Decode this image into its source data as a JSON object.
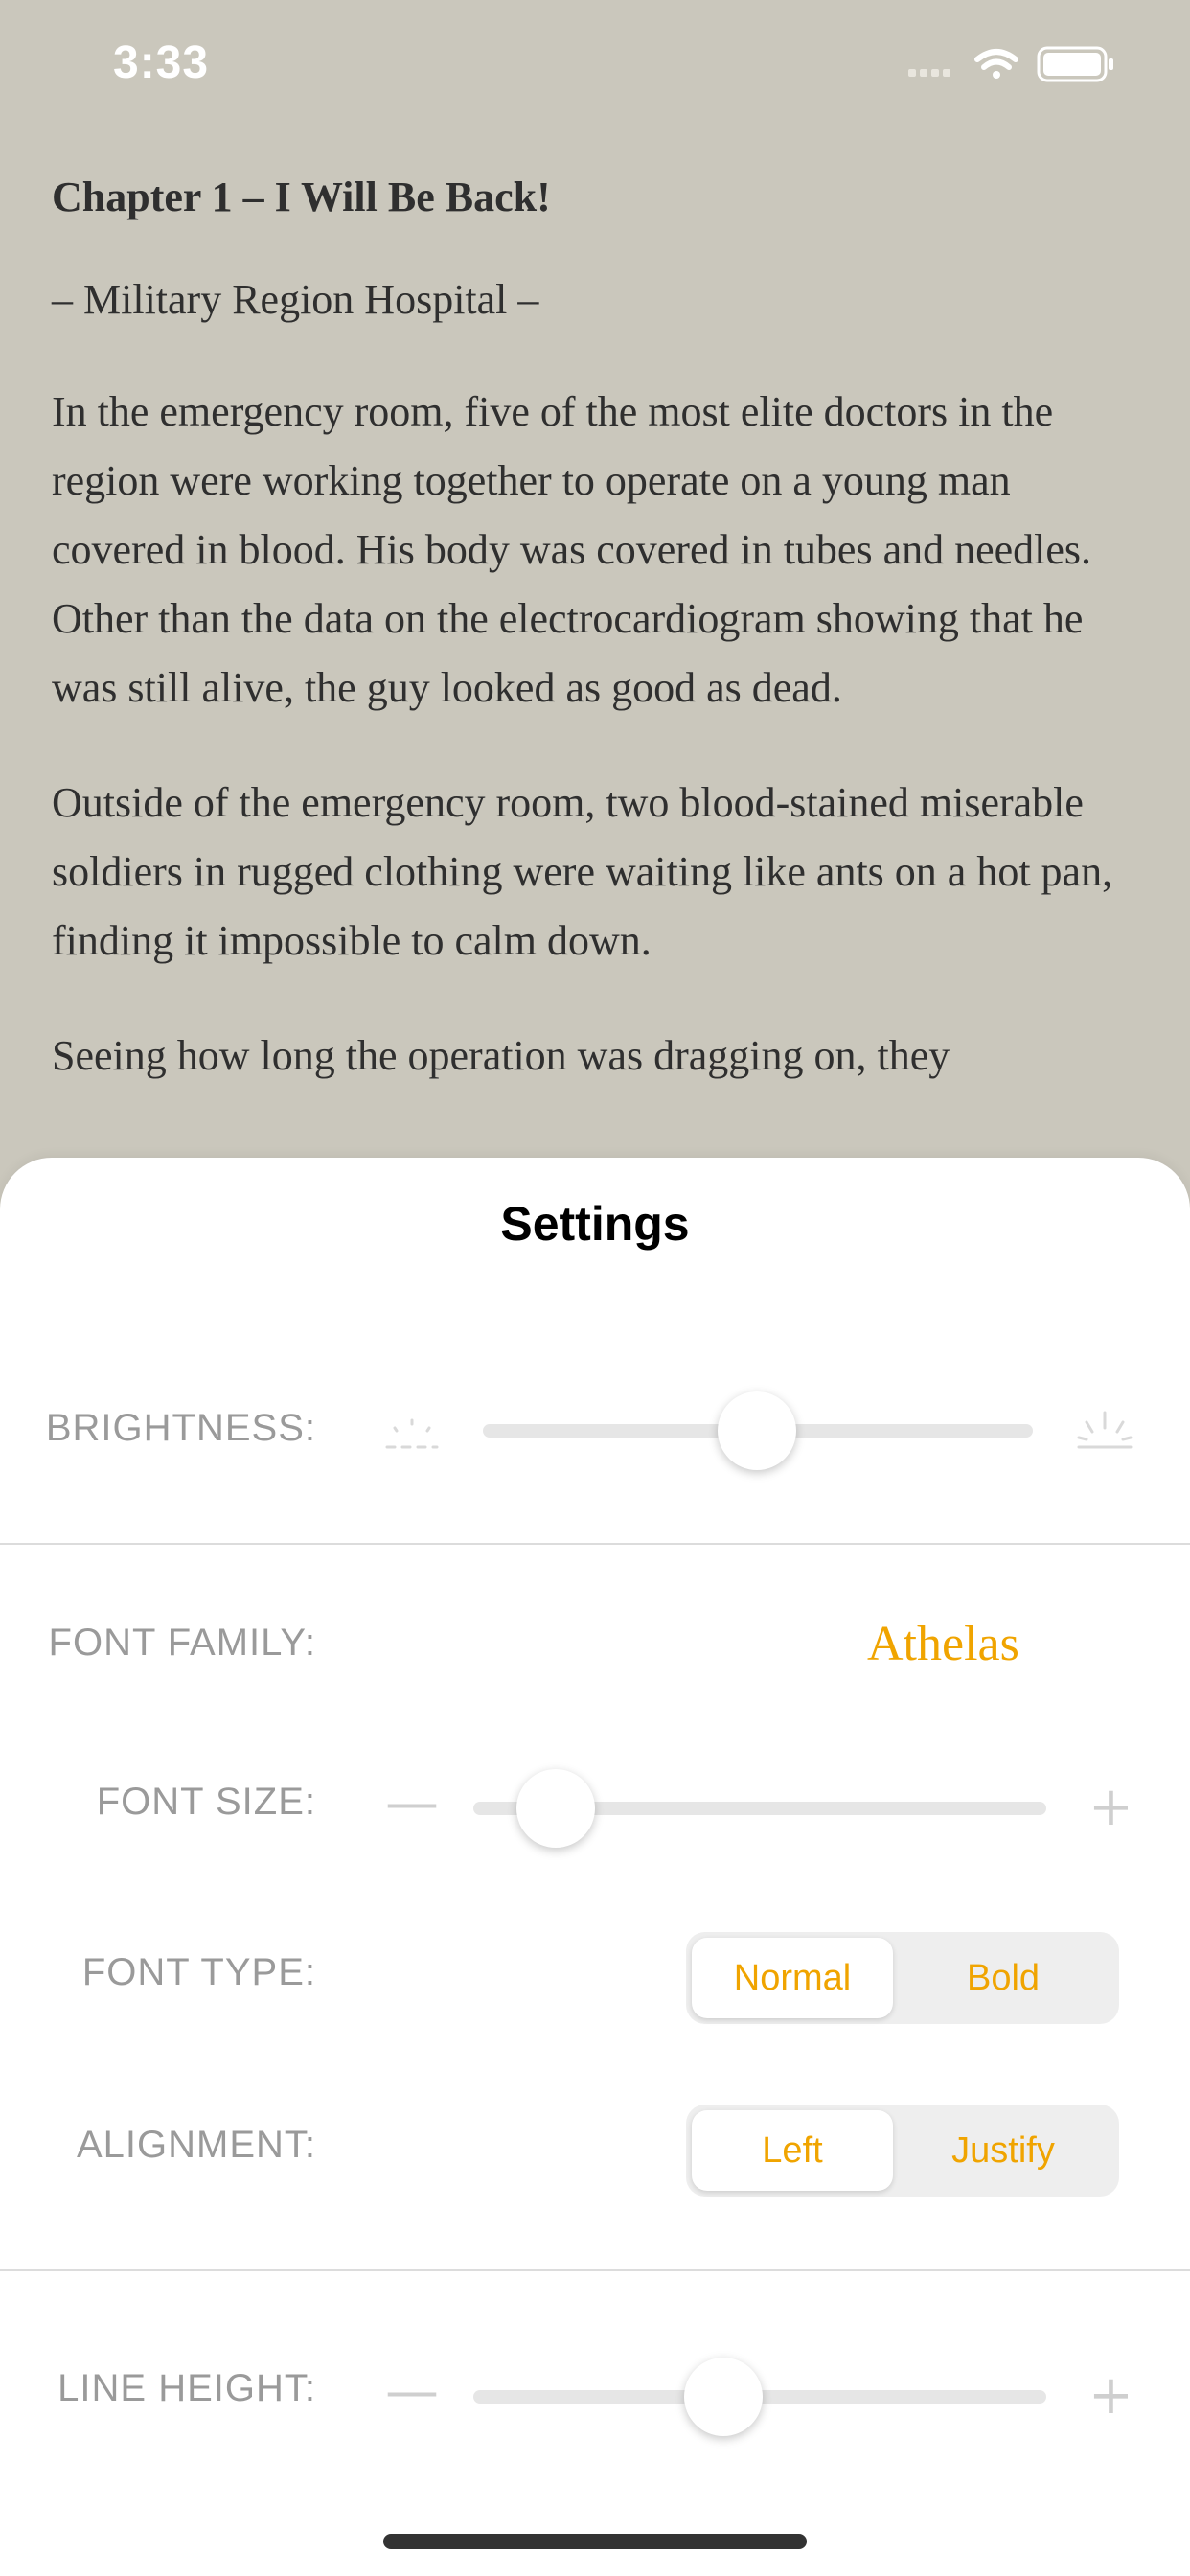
{
  "status": {
    "time": "3:33"
  },
  "reader": {
    "chapter_title": "Chapter 1 – I Will Be Back!",
    "subtitle": "– Military Region Hospital –",
    "paragraphs": [
      "In the emergency room, five of the most elite doctors in the region were working together to operate on a young man covered in blood. His body was covered in tubes and needles. Other than the data on the electrocardiogram showing that he was still alive, the guy looked as good as dead.",
      "Outside of the emergency room, two blood-stained miserable soldiers in rugged clothing were waiting like ants on a hot pan, finding it impossible to calm down.",
      "Seeing how long the operation was dragging on, they"
    ]
  },
  "settings": {
    "title": "Settings",
    "brightness": {
      "label": "BRIGHTNESS:",
      "value": 0.5
    },
    "font_family": {
      "label": "FONT FAMILY:",
      "value": "Athelas"
    },
    "font_size": {
      "label": "FONT SIZE:",
      "value": 0.15,
      "minus": "—",
      "plus": "+"
    },
    "font_type": {
      "label": "FONT TYPE:",
      "options": [
        "Normal",
        "Bold"
      ],
      "selected": "Normal"
    },
    "alignment": {
      "label": "ALIGNMENT:",
      "options": [
        "Left",
        "Justify"
      ],
      "selected": "Left"
    },
    "line_height": {
      "label": "LINE HEIGHT:",
      "value": 0.44,
      "minus": "—",
      "plus": "+"
    }
  },
  "colors": {
    "accent": "#f0a400",
    "background": "#cac7bc",
    "sheet": "#ffffff",
    "label": "#9a9a9a"
  },
  "icons": [
    "wifi-icon",
    "battery-icon",
    "signal-icon",
    "brightness-low-icon",
    "brightness-high-icon"
  ]
}
